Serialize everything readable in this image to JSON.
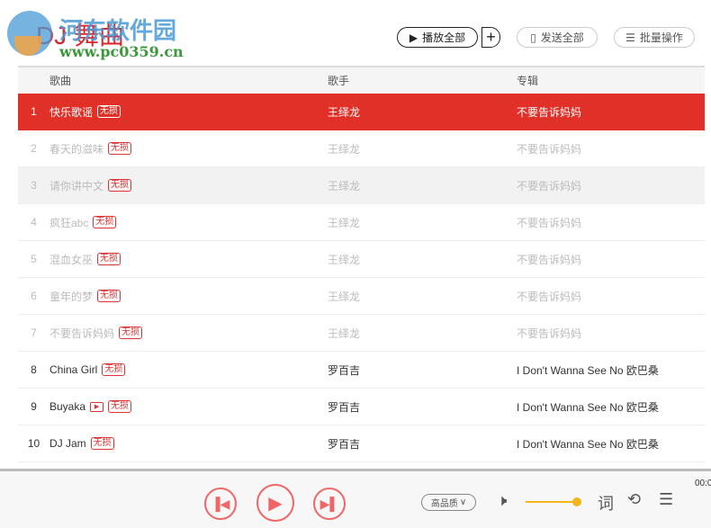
{
  "title": "DJ 舞曲",
  "watermark": {
    "name": "河东软件园",
    "url": "www.pc0359.cn"
  },
  "toolbar": {
    "play_all": "播放全部",
    "add": "+",
    "send_all": "发送全部",
    "batch": "批量操作"
  },
  "table": {
    "headers": {
      "song": "歌曲",
      "singer": "歌手",
      "album": "专辑"
    },
    "rows": [
      {
        "num": "1",
        "song": "快乐歌谣",
        "tag": "无损",
        "singer": "王绎龙",
        "album": "不要告诉妈妈"
      },
      {
        "num": "2",
        "song": "春天的滋味",
        "tag": "无损",
        "singer": "王绎龙",
        "album": "不要告诉妈妈"
      },
      {
        "num": "3",
        "song": "请你讲中文",
        "tag": "无损",
        "singer": "王绎龙",
        "album": "不要告诉妈妈"
      },
      {
        "num": "4",
        "song": "疯狂abc",
        "tag": "无损",
        "singer": "王绎龙",
        "album": "不要告诉妈妈"
      },
      {
        "num": "5",
        "song": "混血女巫",
        "tag": "无损",
        "singer": "王绎龙",
        "album": "不要告诉妈妈"
      },
      {
        "num": "6",
        "song": "童年的梦",
        "tag": "无损",
        "singer": "王绎龙",
        "album": "不要告诉妈妈"
      },
      {
        "num": "7",
        "song": "不要告诉妈妈",
        "tag": "无损",
        "singer": "王绎龙",
        "album": "不要告诉妈妈"
      },
      {
        "num": "8",
        "song": "China Girl",
        "tag": "无损",
        "singer": "罗百吉",
        "album": "I Don't Wanna See No 欧巴桑"
      },
      {
        "num": "9",
        "song": "Buyaka",
        "tag": "无损",
        "singer": "罗百吉",
        "album": "I Don't Wanna See No 欧巴桑"
      },
      {
        "num": "10",
        "song": "DJ Jam",
        "tag": "无损",
        "singer": "罗百吉",
        "album": "I Don't Wanna See No 欧巴桑"
      }
    ]
  },
  "player": {
    "quality": "高品质",
    "lyrics": "词",
    "time": "00:0",
    "volume": 1.0
  },
  "colors": {
    "accent": "#e03028",
    "volume": "#f3b519"
  }
}
